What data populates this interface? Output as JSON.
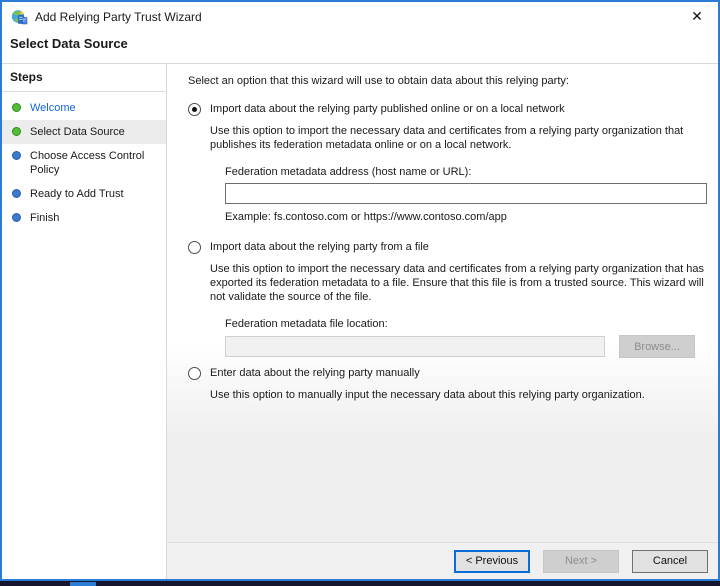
{
  "window": {
    "title": "Add Relying Party Trust Wizard",
    "close_glyph": "✕"
  },
  "header": {
    "title": "Select Data Source"
  },
  "sidebar": {
    "title": "Steps",
    "items": [
      {
        "label": "Welcome",
        "state": "done",
        "current": false
      },
      {
        "label": "Select Data Source",
        "state": "done",
        "current": true
      },
      {
        "label": "Choose Access Control Policy",
        "state": "todo",
        "current": false
      },
      {
        "label": "Ready to Add Trust",
        "state": "todo",
        "current": false
      },
      {
        "label": "Finish",
        "state": "todo",
        "current": false
      }
    ]
  },
  "content": {
    "instruction": "Select an option that this wizard will use to obtain data about this relying party:",
    "option_online": {
      "label": "Import data about the relying party published online or on a local network",
      "selected": true,
      "description": "Use this option to import the necessary data and certificates from a relying party organization that publishes its federation metadata online or on a local network.",
      "address_label": "Federation metadata address (host name or URL):",
      "address_value": "",
      "example": "Example: fs.contoso.com or https://www.contoso.com/app"
    },
    "option_file": {
      "label": "Import data about the relying party from a file",
      "selected": false,
      "description": "Use this option to import the necessary data and certificates from a relying party organization that has exported its federation metadata to a file. Ensure that this file is from a trusted source.  This wizard will not validate the source of the file.",
      "file_label": "Federation metadata file location:",
      "file_value": "",
      "browse_label": "Browse..."
    },
    "option_manual": {
      "label": "Enter data about the relying party manually",
      "selected": false,
      "description": "Use this option to manually input the necessary data about this relying party organization."
    }
  },
  "footer": {
    "previous_label": "< Previous",
    "next_label": "Next >",
    "cancel_label": "Cancel"
  },
  "colors": {
    "window_border": "#2b7cd4",
    "step_done_bullet": "#52bd38",
    "step_todo_bullet": "#3a7ad1",
    "link_blue": "#1566d8",
    "focus_border": "#0a6cd6",
    "footer_bg": "#f0f0f0"
  }
}
